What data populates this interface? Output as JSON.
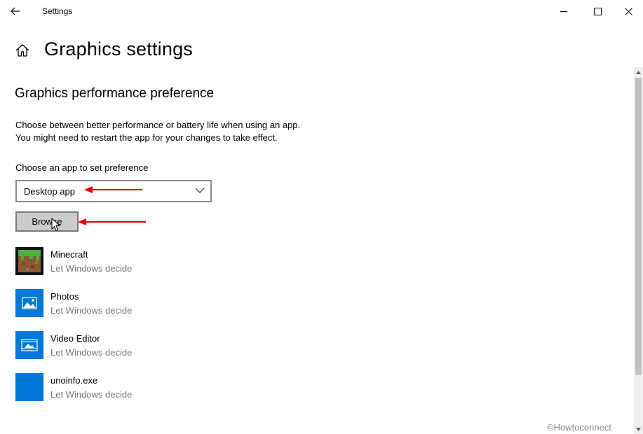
{
  "window": {
    "title": "Settings",
    "back_icon": "arrow-left-icon",
    "controls": [
      "minimize-icon",
      "maximize-icon",
      "close-icon"
    ]
  },
  "header": {
    "home_icon": "home-icon",
    "title": "Graphics settings"
  },
  "section": {
    "title": "Graphics performance preference",
    "description_line1": "Choose between better performance or battery life when using an app.",
    "description_line2": "You might need to restart the app for your changes to take effect.",
    "choose_label": "Choose an app to set preference"
  },
  "app_type_dropdown": {
    "selected": "Desktop app"
  },
  "browse_button": {
    "label": "Browse"
  },
  "apps": [
    {
      "name": "Minecraft",
      "preference": "Let Windows decide",
      "icon": "minecraft-icon"
    },
    {
      "name": "Photos",
      "preference": "Let Windows decide",
      "icon": "photos-icon"
    },
    {
      "name": "Video Editor",
      "preference": "Let Windows decide",
      "icon": "video-editor-icon"
    },
    {
      "name": "unoinfo.exe",
      "preference": "Let Windows decide",
      "icon": "exe-icon"
    }
  ],
  "annotations": {
    "arrow_color": "#e00000"
  },
  "colors": {
    "accent": "#0078d7",
    "secondary_text": "#767676"
  },
  "watermark": "©Howtoconnect"
}
